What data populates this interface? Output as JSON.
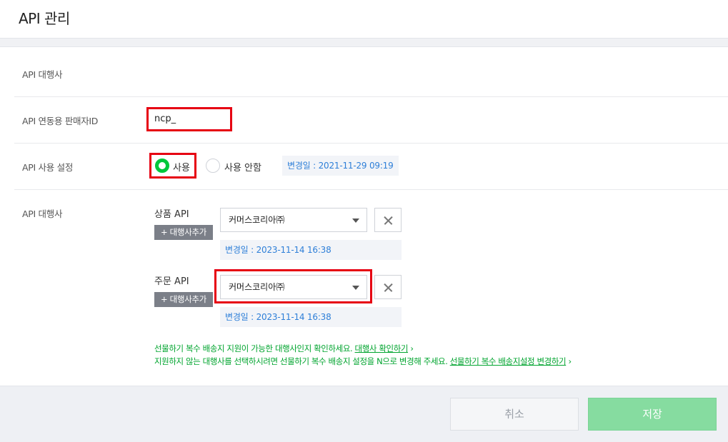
{
  "page": {
    "title": "API 관리"
  },
  "agency_row": {
    "label": "API 대행사"
  },
  "seller_id": {
    "label": "API 연동용 판매자ID",
    "value": "ncp_"
  },
  "api_usage": {
    "label": "API 사용 설정",
    "options": [
      {
        "label": "사용",
        "selected": true
      },
      {
        "label": "사용 안함",
        "selected": false
      }
    ],
    "changed_date": "변경일 : 2021-11-29 09:19"
  },
  "agencies": {
    "label": "API 대행사",
    "product": {
      "name": "상품 API",
      "add_label": "+ 대행사추가",
      "selected": "커머스코리아㈜",
      "changed_date": "변경일 : 2023-11-14 16:38"
    },
    "order": {
      "name": "주문 API",
      "add_label": "+ 대행사추가",
      "selected": "커머스코리아㈜",
      "changed_date": "변경일 : 2023-11-14 16:38"
    },
    "note1_text": "선물하기 복수 배송지 지원이 가능한 대행사인지 확인하세요. ",
    "note1_link": "대행사 확인하기",
    "note2_text": "지원하지 않는 대행사를 선택하시려면 선물하기 복수 배송지 설정을 N으로 변경해 주세요. ",
    "note2_link": "선물하기 복수 배송지설정 변경하기",
    "chevron": "›"
  },
  "footer": {
    "cancel_label": "취소",
    "save_label": "저장"
  },
  "colors": {
    "accent_green": "#00c73c",
    "link_blue": "#2e7fd8",
    "highlight_red": "#e60012"
  }
}
